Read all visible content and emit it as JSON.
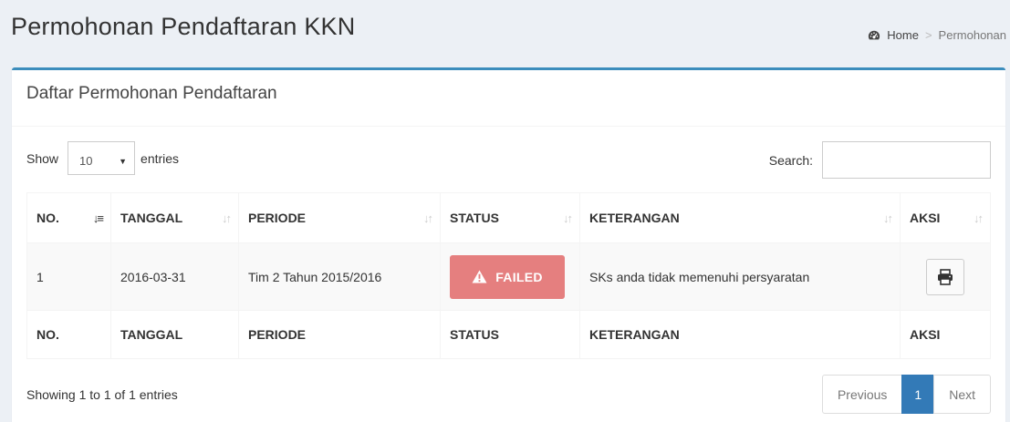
{
  "header": {
    "title": "Permohonan Pendaftaran KKN",
    "breadcrumb": {
      "home": "Home",
      "separator": ">",
      "current": "Permohonan"
    }
  },
  "box": {
    "title": "Daftar Permohonan Pendaftaran",
    "length": {
      "prefix": "Show",
      "selected": "10",
      "suffix": "entries"
    },
    "search": {
      "label": "Search:",
      "value": "",
      "placeholder": ""
    }
  },
  "table": {
    "columns": [
      "NO.",
      "TANGGAL",
      "PERIODE",
      "STATUS",
      "KETERANGAN",
      "AKSI"
    ],
    "rows": [
      {
        "no": "1",
        "tanggal": "2016-03-31",
        "periode": "Tim 2 Tahun 2015/2016",
        "status": "FAILED",
        "keterangan": "SKs anda tidak memenuhi persyaratan",
        "aksi_icon": "print-icon"
      }
    ]
  },
  "footer": {
    "info": "Showing 1 to 1 of 1 entries",
    "pagination": {
      "previous": "Previous",
      "current": "1",
      "next": "Next"
    }
  },
  "colors": {
    "accent": "#3c8dbc",
    "status_failed": "#e57f7f",
    "page_active": "#337ab7",
    "background": "#ecf0f5"
  }
}
